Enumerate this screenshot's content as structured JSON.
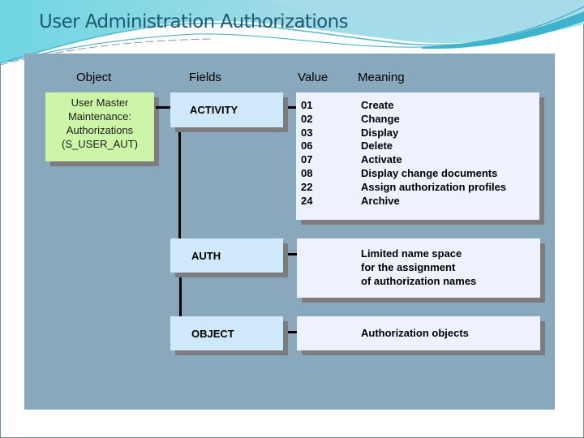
{
  "slide": {
    "title": "User Administration Authorizations"
  },
  "columns": {
    "object": "Object",
    "fields": "Fields",
    "value": "Value",
    "meaning": "Meaning"
  },
  "object": {
    "lines": [
      "User Master",
      "Maintenance:",
      "Authorizations",
      "(S_USER_AUT)"
    ]
  },
  "fields": [
    {
      "name": "ACTIVITY",
      "values": [
        {
          "code": "01",
          "meaning": "Create"
        },
        {
          "code": "02",
          "meaning": "Change"
        },
        {
          "code": "03",
          "meaning": "Display"
        },
        {
          "code": "06",
          "meaning": "Delete"
        },
        {
          "code": "07",
          "meaning": "Activate"
        },
        {
          "code": "08",
          "meaning": "Display change documents"
        },
        {
          "code": "22",
          "meaning": "Assign authorization profiles"
        },
        {
          "code": "24",
          "meaning": "Archive"
        }
      ]
    },
    {
      "name": "AUTH",
      "meaning_lines": [
        "Limited name space",
        "for the assignment",
        "of authorization names"
      ]
    },
    {
      "name": "OBJECT",
      "meaning_lines": [
        "Authorization objects"
      ]
    }
  ],
  "colors": {
    "panel": "#8aa8bc",
    "object_box": "#cdf5a8",
    "field_box": "#cfe8fa",
    "value_box": "#edf2fc",
    "title": "#1c5a74"
  }
}
